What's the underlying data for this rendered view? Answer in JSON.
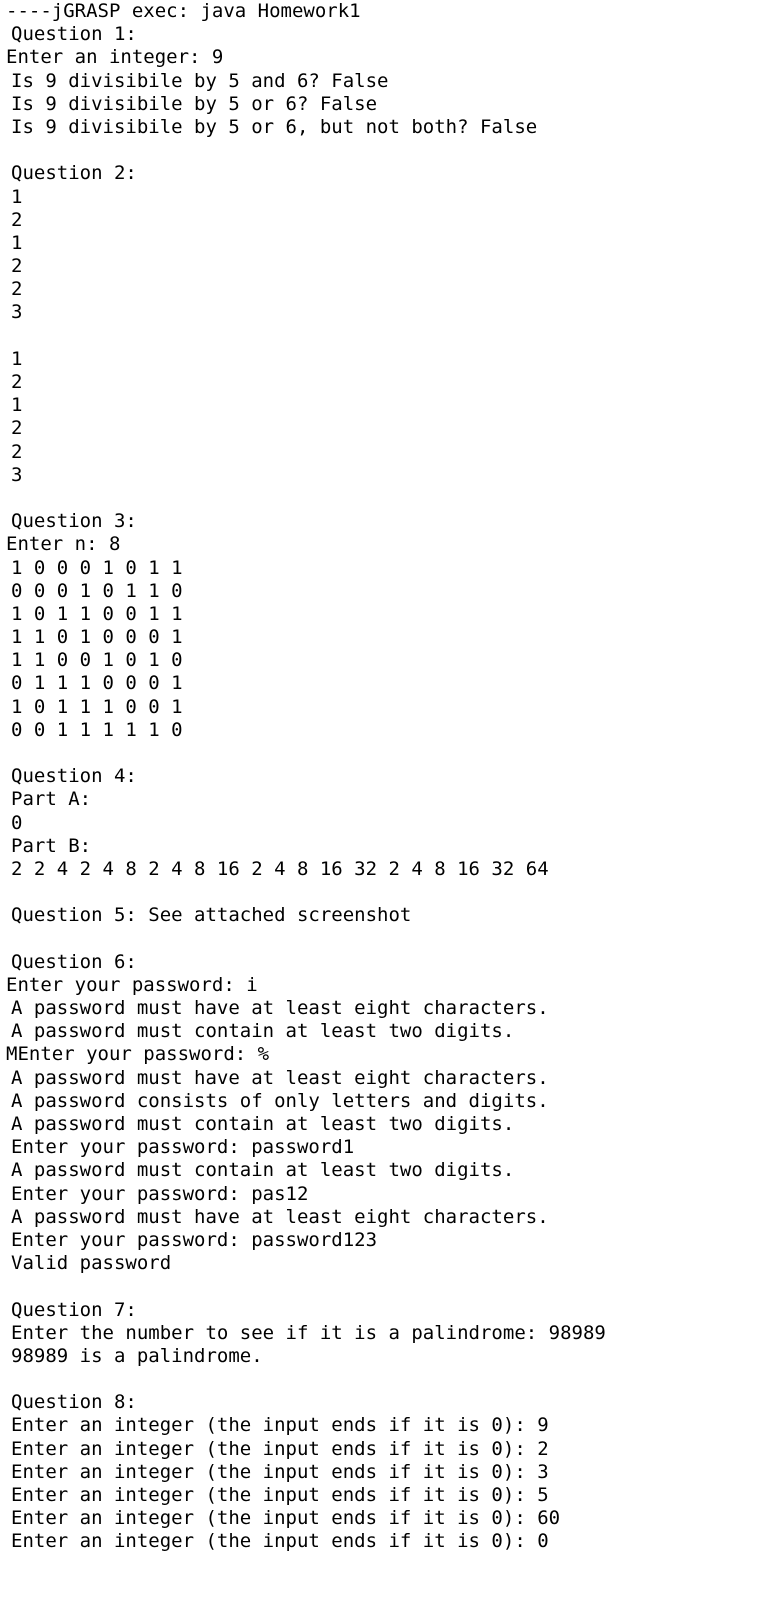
{
  "console": {
    "lines": [
      {
        "text": "----jGRASP exec: java Homework1",
        "indent": false
      },
      {
        "text": "Question 1:",
        "indent": true
      },
      {
        "text": "Enter an integer: 9",
        "indent": false
      },
      {
        "text": "Is 9 divisibile by 5 and 6? False",
        "indent": true
      },
      {
        "text": "Is 9 divisibile by 5 or 6? False",
        "indent": true
      },
      {
        "text": "Is 9 divisibile by 5 or 6, but not both? False",
        "indent": true
      },
      {
        "text": "",
        "indent": true
      },
      {
        "text": "Question 2:",
        "indent": true
      },
      {
        "text": "1",
        "indent": true
      },
      {
        "text": "2",
        "indent": true
      },
      {
        "text": "1",
        "indent": true
      },
      {
        "text": "2",
        "indent": true
      },
      {
        "text": "2",
        "indent": true
      },
      {
        "text": "3",
        "indent": true
      },
      {
        "text": "",
        "indent": true
      },
      {
        "text": "1",
        "indent": true
      },
      {
        "text": "2",
        "indent": true
      },
      {
        "text": "1",
        "indent": true
      },
      {
        "text": "2",
        "indent": true
      },
      {
        "text": "2",
        "indent": true
      },
      {
        "text": "3",
        "indent": true
      },
      {
        "text": "",
        "indent": true
      },
      {
        "text": "Question 3:",
        "indent": true
      },
      {
        "text": "Enter n: 8",
        "indent": false
      },
      {
        "text": "1 0 0 0 1 0 1 1",
        "indent": true
      },
      {
        "text": "0 0 0 1 0 1 1 0",
        "indent": true
      },
      {
        "text": "1 0 1 1 0 0 1 1",
        "indent": true
      },
      {
        "text": "1 1 0 1 0 0 0 1",
        "indent": true
      },
      {
        "text": "1 1 0 0 1 0 1 0",
        "indent": true
      },
      {
        "text": "0 1 1 1 0 0 0 1",
        "indent": true
      },
      {
        "text": "1 0 1 1 1 0 0 1",
        "indent": true
      },
      {
        "text": "0 0 1 1 1 1 1 0",
        "indent": true
      },
      {
        "text": "",
        "indent": true
      },
      {
        "text": "Question 4:",
        "indent": true
      },
      {
        "text": "Part A:",
        "indent": true
      },
      {
        "text": "0",
        "indent": true
      },
      {
        "text": "Part B:",
        "indent": true
      },
      {
        "text": "2 2 4 2 4 8 2 4 8 16 2 4 8 16 32 2 4 8 16 32 64",
        "indent": true
      },
      {
        "text": "",
        "indent": true
      },
      {
        "text": "Question 5: See attached screenshot",
        "indent": true
      },
      {
        "text": "",
        "indent": true
      },
      {
        "text": "Question 6:",
        "indent": true
      },
      {
        "text": "Enter your password: i",
        "indent": false
      },
      {
        "text": "A password must have at least eight characters.",
        "indent": true
      },
      {
        "text": "A password must contain at least two digits.",
        "indent": true
      },
      {
        "text": "MEnter your password: %",
        "indent": false
      },
      {
        "text": "A password must have at least eight characters.",
        "indent": true
      },
      {
        "text": "A password consists of only letters and digits.",
        "indent": true
      },
      {
        "text": "A password must contain at least two digits.",
        "indent": true
      },
      {
        "text": "Enter your password: password1",
        "indent": true
      },
      {
        "text": "A password must contain at least two digits.",
        "indent": true
      },
      {
        "text": "Enter your password: pas12",
        "indent": true
      },
      {
        "text": "A password must have at least eight characters.",
        "indent": true
      },
      {
        "text": "Enter your password: password123",
        "indent": true
      },
      {
        "text": "Valid password",
        "indent": true
      },
      {
        "text": "",
        "indent": true
      },
      {
        "text": "Question 7:",
        "indent": true
      },
      {
        "text": "Enter the number to see if it is a palindrome: 98989",
        "indent": true
      },
      {
        "text": "98989 is a palindrome.",
        "indent": true
      },
      {
        "text": "",
        "indent": true
      },
      {
        "text": "Question 8:",
        "indent": true
      },
      {
        "text": "Enter an integer (the input ends if it is 0): 9",
        "indent": true
      },
      {
        "text": "Enter an integer (the input ends if it is 0): 2",
        "indent": true
      },
      {
        "text": "Enter an integer (the input ends if it is 0): 3",
        "indent": true
      },
      {
        "text": "Enter an integer (the input ends if it is 0): 5",
        "indent": true
      },
      {
        "text": "Enter an integer (the input ends if it is 0): 60",
        "indent": true
      },
      {
        "text": "Enter an integer (the input ends if it is 0): 0",
        "indent": true
      }
    ]
  }
}
